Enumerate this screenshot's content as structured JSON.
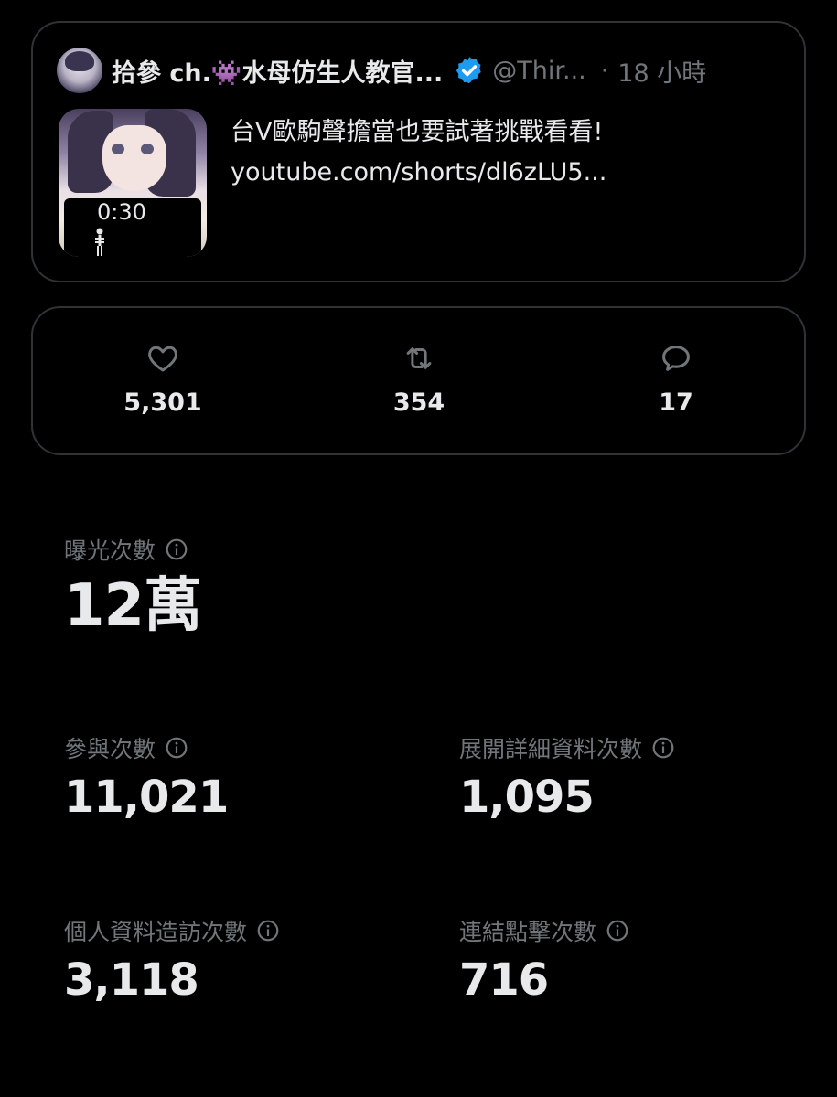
{
  "colors": {
    "background": "#000000",
    "border": "#2f3336",
    "primary_text": "#e7e9ea",
    "secondary_text": "#71767b",
    "verified_blue": "#1d9bf0"
  },
  "tweet": {
    "display_name": "拾參 ch.👾水母仿生人教官...",
    "verified_icon": "verified-badge-icon",
    "handle": "@Thir...",
    "separator": "·",
    "time": "18 小時",
    "media": {
      "duration": "0:30"
    },
    "text_line1": "台V歐駒聲擔當也要試著挑戰看看!",
    "text_line2": "youtube.com/shorts/dl6zLU5..."
  },
  "engagement": {
    "likes": {
      "icon": "heart-icon",
      "count": "5,301"
    },
    "reposts": {
      "icon": "repost-icon",
      "count": "354"
    },
    "replies": {
      "icon": "reply-icon",
      "count": "17"
    }
  },
  "analytics": {
    "impressions": {
      "label": "曝光次數",
      "value": "12萬"
    },
    "engagements": {
      "label": "參與次數",
      "value": "11,021"
    },
    "detail_expands": {
      "label": "展開詳細資料次數",
      "value": "1,095"
    },
    "profile_visits": {
      "label": "個人資料造訪次數",
      "value": "3,118"
    },
    "link_clicks": {
      "label": "連結點擊次數",
      "value": "716"
    }
  }
}
